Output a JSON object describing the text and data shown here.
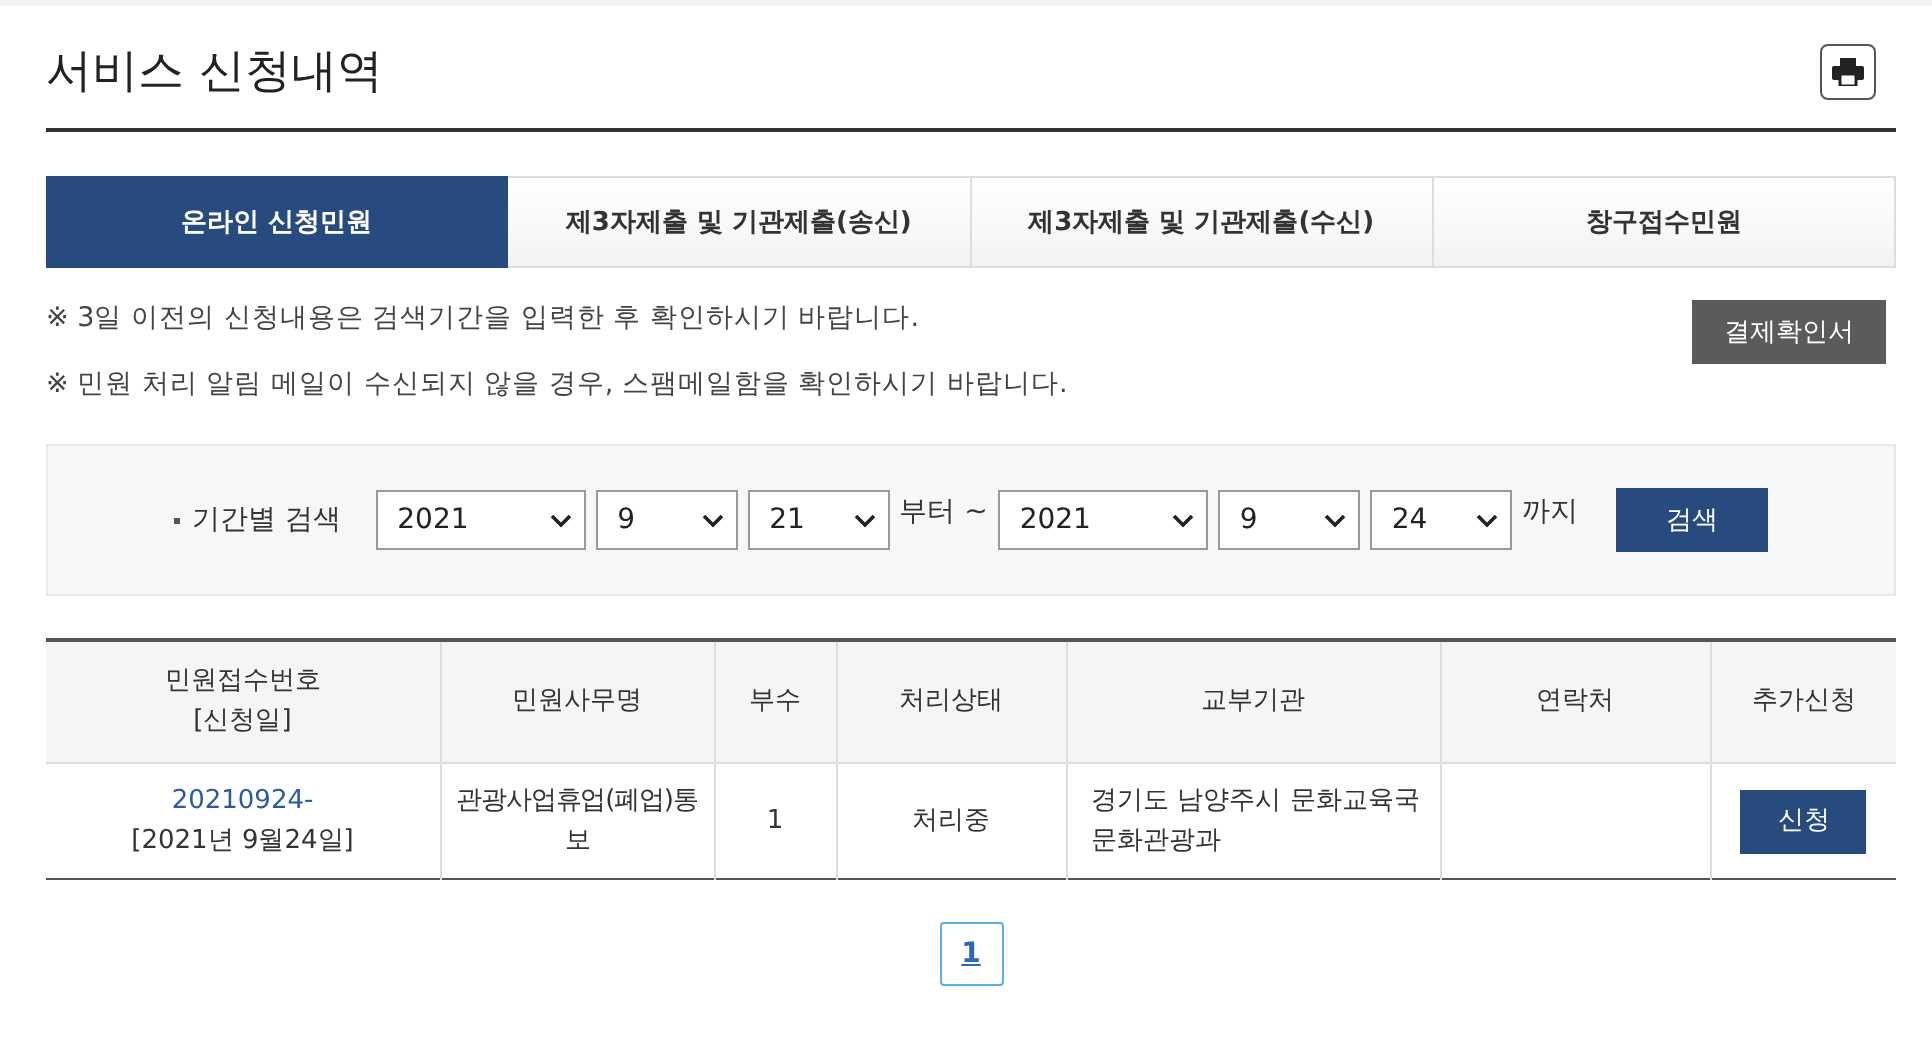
{
  "page": {
    "title": "서비스 신청내역"
  },
  "tabs": [
    {
      "label": "온라인 신청민원",
      "selected": true
    },
    {
      "label": "제3자제출 및 기관제출(송신)",
      "selected": false
    },
    {
      "label": "제3자제출 및 기관제출(수신)",
      "selected": false
    },
    {
      "label": "창구접수민원",
      "selected": false
    }
  ],
  "notices": [
    "※ 3일 이전의 신청내용은 검색기간을 입력한 후 확인하시기 바랍니다.",
    "※ 민원 처리 알림 메일이 수신되지 않을 경우, 스팸메일함을 확인하시기 바랍니다."
  ],
  "payment_button": "결제확인서",
  "search": {
    "label": "기간별 검색",
    "from": [
      "2021",
      "9",
      "21"
    ],
    "from_suffix": "부터 ~",
    "to": [
      "2021",
      "9",
      "24"
    ],
    "to_suffix": "까지",
    "button": "검색"
  },
  "table": {
    "columns": [
      [
        "민원접수번호",
        "[신청일]"
      ],
      [
        "민원사무명"
      ],
      [
        "부수"
      ],
      [
        "처리상태"
      ],
      [
        "교부기관"
      ],
      [
        "연락처"
      ],
      [
        "추가신청"
      ]
    ],
    "rows": [
      {
        "number": "20210924-",
        "date": "[2021년 9월24일]",
        "service": "관광사업휴업(폐업)통보",
        "copies": "1",
        "status": "처리중",
        "office": "경기도 남양주시 문화교육국 문화관광과",
        "contact": "",
        "action": "신청"
      }
    ]
  },
  "pagination": [
    {
      "label": "1",
      "selected": true
    }
  ]
}
